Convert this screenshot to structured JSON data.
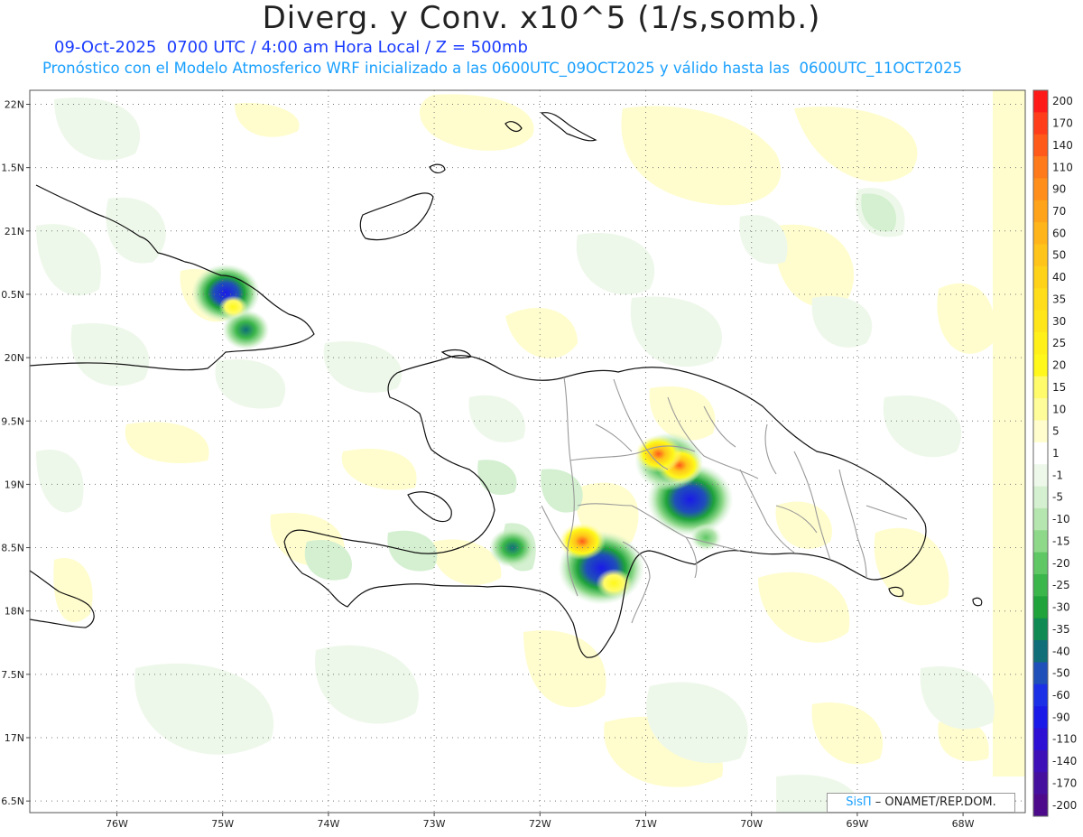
{
  "header": {
    "title": "Diverg. y Conv. x10^5 (1/s,somb.)",
    "line1": "09-Oct-2025  0700 UTC / 4:00 am Hora Local / Z = 500mb",
    "line2": "Pronóstico con el Modelo Atmosferico WRF inicializado a las 0600UTC_09OCT2025 y válido hasta las  0600UTC_11OCT2025"
  },
  "axes": {
    "lat_labels": [
      "22N",
      "1.5N",
      "21N",
      "0.5N",
      "20N",
      "9.5N",
      "19N",
      "8.5N",
      "18N",
      "7.5N",
      "17N",
      "6.5N"
    ],
    "lon_labels": [
      "76W",
      "75W",
      "74W",
      "73W",
      "72W",
      "71W",
      "70W",
      "69W",
      "68W"
    ]
  },
  "colorbar": {
    "labels": [
      "200",
      "170",
      "140",
      "110",
      "90",
      "70",
      "60",
      "50",
      "40",
      "35",
      "30",
      "25",
      "20",
      "15",
      "10",
      "5",
      "1",
      "-1",
      "-5",
      "-10",
      "-15",
      "-20",
      "-25",
      "-30",
      "-35",
      "-40",
      "-50",
      "-60",
      "-90",
      "-110",
      "-140",
      "-170",
      "-200"
    ],
    "colors": [
      "#ff1a1a",
      "#ff3d1a",
      "#ff5a1a",
      "#ff7a1a",
      "#ff8f1a",
      "#ffa31a",
      "#ffb51a",
      "#ffc41a",
      "#ffd21a",
      "#ffdd1a",
      "#ffe61a",
      "#fff01a",
      "#fff81a",
      "#fffb6a",
      "#fffc9a",
      "#fffdcd",
      "#ffffff",
      "#eef8ea",
      "#d4f0d0",
      "#b6e6b0",
      "#8ed88a",
      "#5fc764",
      "#3bb64a",
      "#1fa33a",
      "#0e8a52",
      "#0f6e78",
      "#1f4fb8",
      "#1a2fe6",
      "#1a1ae8",
      "#2d10d4",
      "#3d10b8",
      "#46109e",
      "#4d0a8a"
    ]
  },
  "map_features": {
    "convergence_centers": [
      {
        "lon": -71.42,
        "lat": 18.34,
        "value": -110
      },
      {
        "lon": -70.58,
        "lat": 18.88,
        "value": -90
      },
      {
        "lon": -74.97,
        "lat": 20.51,
        "value": -60
      },
      {
        "lon": -70.78,
        "lat": 19.18,
        "value": -50
      },
      {
        "lon": -74.78,
        "lat": 20.22,
        "value": -30
      },
      {
        "lon": -72.26,
        "lat": 18.5,
        "value": -25
      },
      {
        "lon": -70.43,
        "lat": 18.58,
        "value": -20
      }
    ],
    "divergence_centers": [
      {
        "lon": -71.6,
        "lat": 18.55,
        "value": 25
      },
      {
        "lon": -71.3,
        "lat": 18.22,
        "value": 20
      },
      {
        "lon": -70.68,
        "lat": 19.15,
        "value": 40
      },
      {
        "lon": -70.88,
        "lat": 19.24,
        "value": 25
      },
      {
        "lon": -74.9,
        "lat": 20.4,
        "value": 5
      }
    ]
  },
  "credit": {
    "sis": "SisΠ",
    "text": " – ONAMET/REP.DOM."
  }
}
